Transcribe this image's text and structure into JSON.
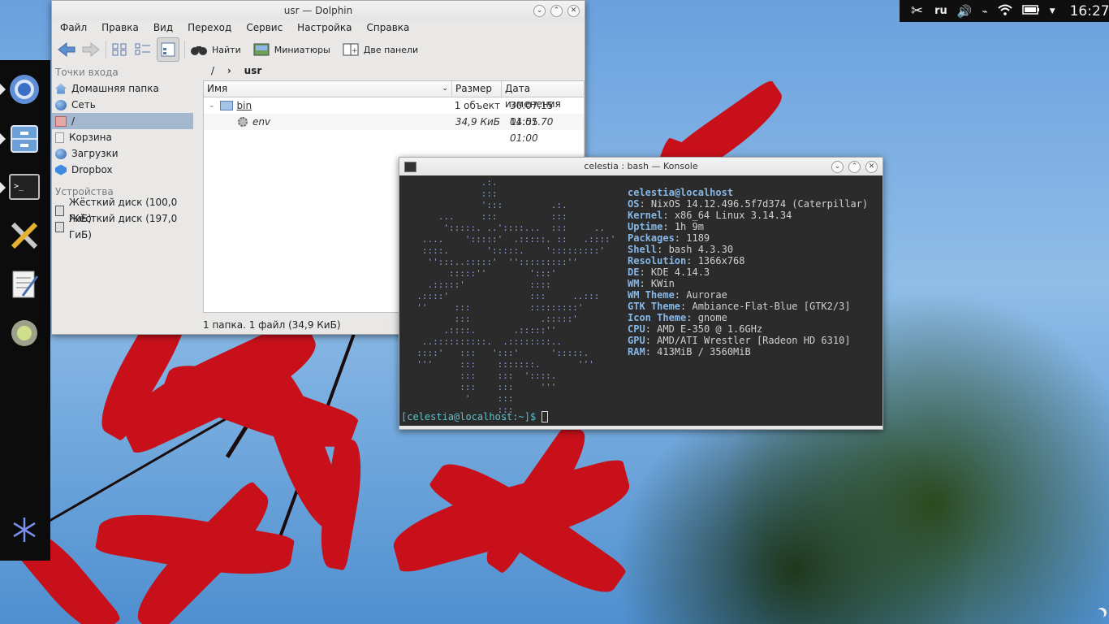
{
  "dolphin": {
    "title": "usr — Dolphin",
    "menu": [
      "Файл",
      "Правка",
      "Вид",
      "Переход",
      "Сервис",
      "Настройка",
      "Справка"
    ],
    "toolbar": {
      "find": "Найти",
      "thumbnails": "Миниатюры",
      "split": "Две панели"
    },
    "places_header": "Точки входа",
    "places": [
      "Домашняя папка",
      "Сеть",
      "/",
      "Корзина",
      "Загрузки",
      "Dropbox"
    ],
    "devices_header": "Устройства",
    "devices": [
      "Жёсткий диск (100,0 ГиБ)",
      "Жёсткий диск (197,0 ГиБ)"
    ],
    "breadcrumb": {
      "root": "/",
      "sep": "›",
      "current": "usr"
    },
    "columns": {
      "name": "Имя",
      "size": "Размер",
      "date": "Дата изменения"
    },
    "rows": [
      {
        "name": "bin",
        "size": "1 объект",
        "date": "30.07.15 14:55"
      },
      {
        "name": "env",
        "size": "34,9 КиБ",
        "date": "01.01.70 01:00"
      }
    ],
    "status": "1 папка. 1 файл (34,9 КиБ)"
  },
  "konsole": {
    "title": "celestia : bash — Konsole",
    "header": "celestia@localhost",
    "info": [
      {
        "k": "OS",
        "v": "NixOS 14.12.496.5f7d374 (Caterpillar)"
      },
      {
        "k": "Kernel",
        "v": "x86_64 Linux 3.14.34"
      },
      {
        "k": "Uptime",
        "v": "1h 9m"
      },
      {
        "k": "Packages",
        "v": "1189"
      },
      {
        "k": "Shell",
        "v": "bash 4.3.30"
      },
      {
        "k": "Resolution",
        "v": "1366x768"
      },
      {
        "k": "DE",
        "v": "KDE 4.14.3"
      },
      {
        "k": "WM",
        "v": "KWin"
      },
      {
        "k": "WM Theme",
        "v": "Aurorae"
      },
      {
        "k": "GTK Theme",
        "v": "Ambiance-Flat-Blue [GTK2/3]"
      },
      {
        "k": "Icon Theme",
        "v": "gnome"
      },
      {
        "k": "CPU",
        "v": "AMD E-350 @ 1.6GHz"
      },
      {
        "k": "GPU",
        "v": "AMD/ATI Wrestler [Radeon HD 6310]"
      },
      {
        "k": "RAM",
        "v": "413MiB / 3560MiB"
      }
    ],
    "prompt": "[celestia@localhost:~]$ "
  },
  "panel": {
    "lang": "ru",
    "time": "16:27"
  },
  "colors": {
    "accent": "#86b7e6",
    "prompt": "#5fc0c8",
    "selection": "#a3b8cf"
  }
}
